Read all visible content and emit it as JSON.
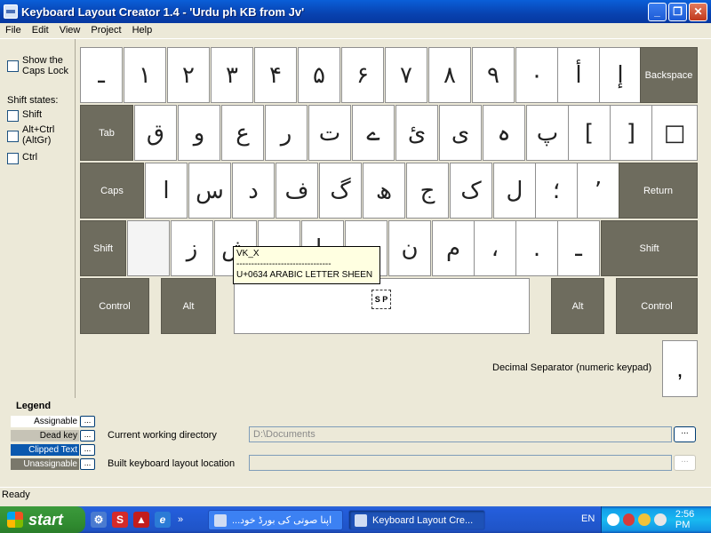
{
  "window": {
    "title": "Keyboard Layout Creator 1.4 - 'Urdu ph KB from Jv'",
    "btn_min": "_",
    "btn_max": "❐",
    "btn_close": "✕"
  },
  "menu": [
    "File",
    "Edit",
    "View",
    "Project",
    "Help"
  ],
  "left": {
    "caps_lock": "Show the Caps Lock",
    "shift_states_label": "Shift states:",
    "shift": "Shift",
    "altgr": "Alt+Ctrl (AltGr)",
    "ctrl": "Ctrl"
  },
  "keys": {
    "row1": [
      "ـ",
      "۱",
      "۲",
      "۳",
      "۴",
      "۵",
      "۶",
      "۷",
      "۸",
      "۹",
      "۰",
      "أ",
      "إ"
    ],
    "backspace": "Backspace",
    "tab": "Tab",
    "row2": [
      "ق",
      "و",
      "ع",
      "ر",
      "ت",
      "ے",
      "ئ",
      "ی",
      "ہ",
      "پ",
      "[",
      "]",
      "□"
    ],
    "caps": "Caps",
    "row3": [
      "ا",
      "س",
      "د",
      "ف",
      "گ",
      "ھ",
      "ج",
      "ک",
      "ل",
      "؛",
      "’"
    ],
    "return": "Return",
    "shift_left": "Shift",
    "row4": [
      "",
      "ز",
      "ش",
      "چ",
      "ط",
      "ب",
      "ن",
      "م",
      "،",
      ".",
      "ـ"
    ],
    "shift_right": "Shift",
    "control_left": "Control",
    "alt_left": "Alt",
    "alt_right": "Alt",
    "control_right": "Control"
  },
  "tooltip": {
    "line1": "VK_X",
    "line2": "--------------------------------",
    "line3": "U+0634   ARABIC LETTER SHEEN"
  },
  "space_marker": "S P",
  "decimal": {
    "label": "Decimal Separator (numeric keypad)",
    "key": ","
  },
  "legend": {
    "title": "Legend",
    "items": [
      {
        "label": "Assignable",
        "bg": "#FFFFFF",
        "fg": "#000000"
      },
      {
        "label": "Dead key",
        "bg": "#C6C3B6",
        "fg": "#000000"
      },
      {
        "label": "Clipped Text",
        "bg": "#0A58AE",
        "fg": "#FFFFFF"
      },
      {
        "label": "Unassignable",
        "bg": "#7A786B",
        "fg": "#FFFFFF"
      }
    ],
    "btn": "..."
  },
  "dirs": {
    "current_label": "Current working directory",
    "current_value": "D:\\Documents",
    "built_label": "Built keyboard layout location",
    "built_value": "",
    "browse": "..."
  },
  "status": "Ready",
  "taskbar": {
    "start": "start",
    "chevron": "»",
    "task1": "...اپنا صوتی کی بورڈ خود",
    "task2": "Keyboard Layout Cre...",
    "lang": "EN",
    "clock": "2:56 PM"
  }
}
